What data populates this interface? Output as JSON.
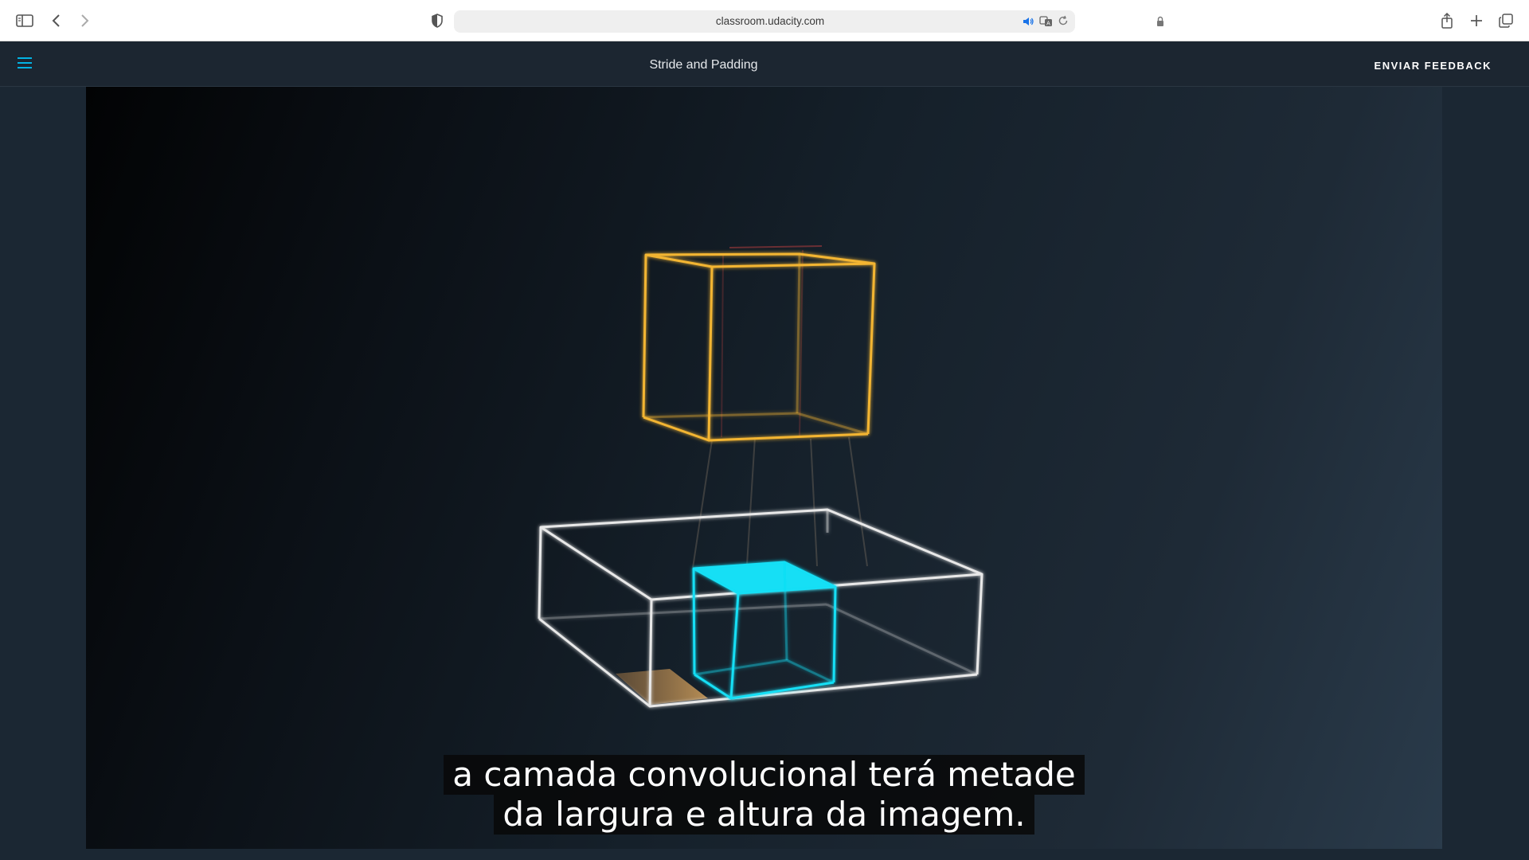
{
  "browser": {
    "url": "classroom.udacity.com",
    "icons": [
      "sidebar-icon",
      "back-icon",
      "forward-icon",
      "shield-icon",
      "lock-icon",
      "speaker-icon",
      "translate-icon",
      "reload-icon",
      "share-icon",
      "new-tab-icon",
      "tab-overview-icon"
    ]
  },
  "header": {
    "title": "Stride and Padding",
    "feedback_label": "ENVIAR FEEDBACK",
    "menu_icon": "hamburger-menu-icon",
    "accent": "#02b3e4"
  },
  "video": {
    "caption_line1": "a camada convolucional terá metade",
    "caption_line2": "da largura e altura da imagem.",
    "colors": {
      "output_cube": "#f3b533",
      "input_volume": "#e8e8e8",
      "filter_patch": "#12dff5",
      "padding": "#b9894f"
    }
  }
}
